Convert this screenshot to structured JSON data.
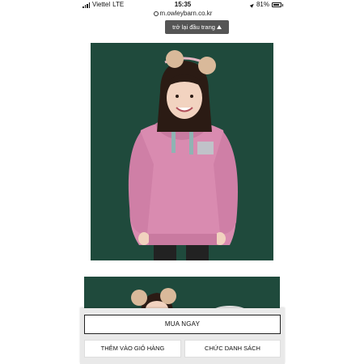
{
  "status": {
    "carrier": "Viettel",
    "network": "LTE",
    "time": "15:35",
    "battery": "81%"
  },
  "browser": {
    "url": "m.owleybarn.co.kr"
  },
  "back_to_top": {
    "label": "trở lại đầu trang"
  },
  "product": {
    "main_image_alt": "girl-in-pink-hoodie-photo",
    "second_image_alt": "girl-with-pompom-headband-photo"
  },
  "actions": {
    "buy_now": "MUA NGAY",
    "add_to_cart": "THÊM VÀO GIỎ HÀNG",
    "wishlist": "CHỨC DANH SÁCH"
  },
  "colors": {
    "background_green": "#1f4a3c",
    "hoodie_pink": "#d98bb0",
    "button_border": "#222222"
  }
}
